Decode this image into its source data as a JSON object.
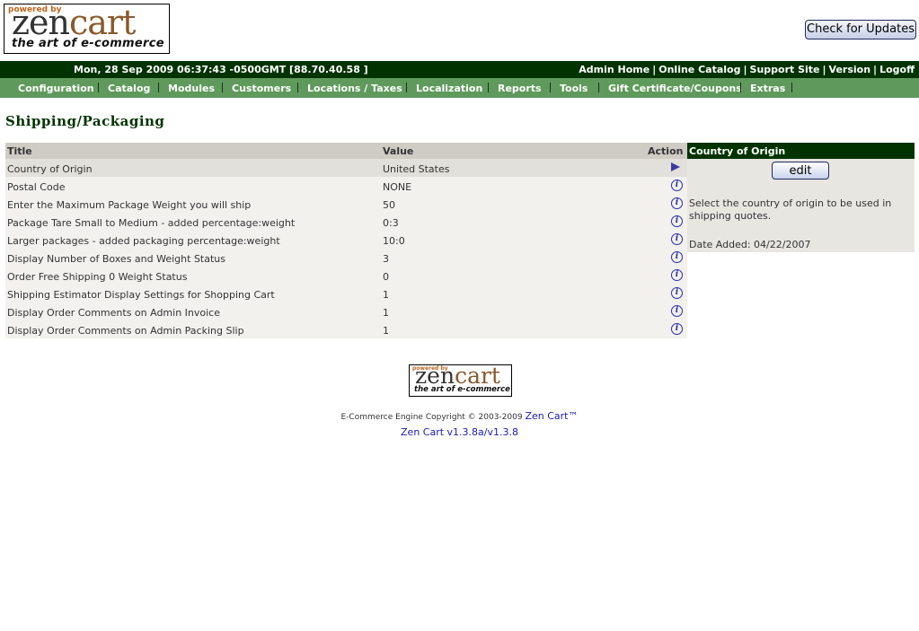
{
  "logo": {
    "powered_by": "powered by",
    "zen": "zen",
    "cart": "cart",
    "tagline": "the art of e-commerce"
  },
  "check_updates_label": "Check for Updates",
  "header": {
    "datetime": "Mon, 28 Sep 2009 06:37:43 -0500GMT [88.70.40.58 ]",
    "links": [
      "Admin Home",
      "Online Catalog",
      "Support Site",
      "Version",
      "Logoff"
    ]
  },
  "menu": [
    "Configuration",
    "Catalog",
    "Modules",
    "Customers",
    "Locations / Taxes",
    "Localization",
    "Reports",
    "Tools",
    "Gift Certificate/Coupons",
    "Extras"
  ],
  "page_title": "Shipping/Packaging",
  "table": {
    "headers": {
      "title": "Title",
      "value": "Value",
      "action": "Action"
    },
    "rows": [
      {
        "title": "Country of Origin",
        "value": "United States",
        "icon": "arrow-icon"
      },
      {
        "title": "Postal Code",
        "value": "NONE",
        "icon": "info-icon"
      },
      {
        "title": "Enter the Maximum Package Weight you will ship",
        "value": "50",
        "icon": "info-icon"
      },
      {
        "title": "Package Tare Small to Medium - added percentage:weight",
        "value": "0:3",
        "icon": "info-icon"
      },
      {
        "title": "Larger packages - added packaging percentage:weight",
        "value": "10:0",
        "icon": "info-icon"
      },
      {
        "title": "Display Number of Boxes and Weight Status",
        "value": "3",
        "icon": "info-icon"
      },
      {
        "title": "Order Free Shipping 0 Weight Status",
        "value": "0",
        "icon": "info-icon"
      },
      {
        "title": "Shipping Estimator Display Settings for Shopping Cart",
        "value": "1",
        "icon": "info-icon"
      },
      {
        "title": "Display Order Comments on Admin Invoice",
        "value": "1",
        "icon": "info-icon"
      },
      {
        "title": "Display Order Comments on Admin Packing Slip",
        "value": "1",
        "icon": "info-icon"
      }
    ]
  },
  "side": {
    "title": "Country of Origin",
    "edit_label": "edit",
    "description": "Select the country of origin to be used in shipping quotes.",
    "date_added": "Date Added: 04/22/2007"
  },
  "footer": {
    "copyright": "E-Commerce Engine Copyright © 2003-2009",
    "zencart_link": "Zen Cart™",
    "version_link": "Zen Cart v1.3.8a/v1.3.8"
  }
}
